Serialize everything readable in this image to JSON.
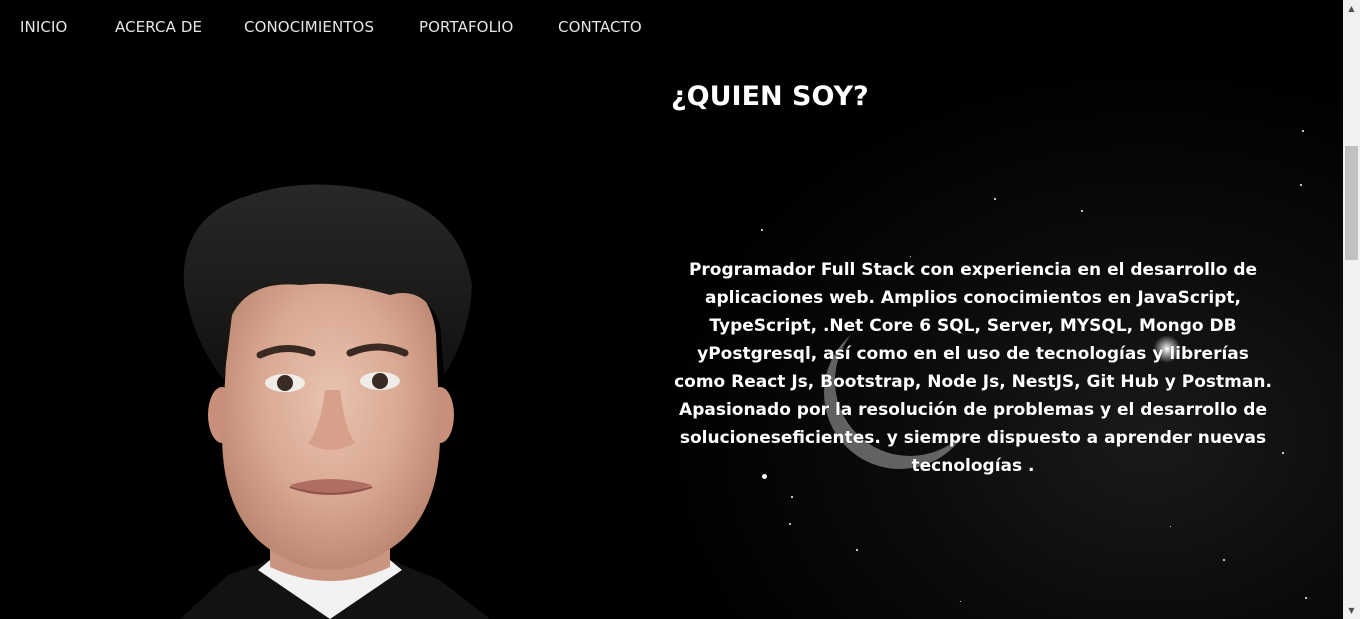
{
  "nav": {
    "items": [
      {
        "label": "INICIO"
      },
      {
        "label": "ACERCA DE"
      },
      {
        "label": "CONOCIMIENTOS"
      },
      {
        "label": "PORTAFOLIO"
      },
      {
        "label": "CONTACTO"
      }
    ]
  },
  "about": {
    "heading": "¿QUIEN SOY?",
    "description": "Programador Full Stack con experiencia en el desarrollo de aplicaciones web. Amplios conocimientos en JavaScript, TypeScript, .Net Core 6 SQL, Server, MYSQL, Mongo DB yPostgresql, así como en el uso de tecnologías y librerías como React Js, Bootstrap, Node Js, NestJS, Git Hub y Postman. Apasionado por la resolución de problemas y el desarrollo de solucioneseficientes. y siempre dispuesto a aprender nuevas tecnologías ."
  },
  "colors": {
    "background": "#000000",
    "text": "#ffffff",
    "nav_text": "#e6e6e6"
  },
  "icons": {
    "scroll_up": "triangle-up-icon",
    "scroll_down": "triangle-down-icon"
  }
}
